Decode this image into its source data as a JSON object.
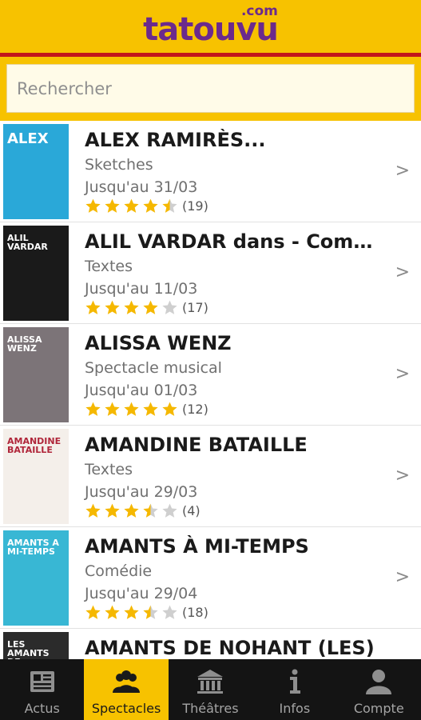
{
  "app": {
    "logo_main": "tatouvu",
    "logo_suffix": ".com",
    "brand_color": "#f7c200",
    "accent_color": "#c2161b",
    "logo_color": "#6b2a8c"
  },
  "search": {
    "placeholder": "Rechercher",
    "value": ""
  },
  "shows": [
    {
      "title": "ALEX RAMIRÈS...",
      "genre": "Sketches",
      "until": "Jusqu'au 31/03",
      "rating": 4.5,
      "reviews": "(19)",
      "poster_text": "ALEX",
      "poster_bg": "#2aa8d8"
    },
    {
      "title": "ALIL VARDAR dans - Commen...",
      "genre": "Textes",
      "until": "Jusqu'au 11/03",
      "rating": 4,
      "reviews": "(17)",
      "poster_text": "ALIL VARDAR",
      "poster_bg": "#1a1a1a"
    },
    {
      "title": "ALISSA WENZ",
      "genre": "Spectacle musical",
      "until": "Jusqu'au 01/03",
      "rating": 5,
      "reviews": "(12)",
      "poster_text": "ALISSA WENZ",
      "poster_bg": "#7c7478"
    },
    {
      "title": "AMANDINE BATAILLE",
      "genre": "Textes",
      "until": "Jusqu'au 29/03",
      "rating": 3.5,
      "reviews": "(4)",
      "poster_text": "AMANDINE BATAILLE",
      "poster_bg": "#f4efea"
    },
    {
      "title": "AMANTS À MI-TEMPS",
      "genre": "Comédie",
      "until": "Jusqu'au 29/04",
      "rating": 3.5,
      "reviews": "(18)",
      "poster_text": "AMANTS A MI-TEMPS",
      "poster_bg": "#38b7d4"
    },
    {
      "title": "AMANTS DE NOHANT (LES)",
      "genre": "",
      "until": "",
      "rating": 0,
      "reviews": "",
      "poster_text": "LES AMANTS DE NOHANT",
      "poster_bg": "#2b2b2b"
    }
  ],
  "tabs": [
    {
      "label": "Actus",
      "icon": "newspaper-icon",
      "active": false
    },
    {
      "label": "Spectacles",
      "icon": "audience-icon",
      "active": true
    },
    {
      "label": "Théâtres",
      "icon": "theater-building-icon",
      "active": false
    },
    {
      "label": "Infos",
      "icon": "info-icon",
      "active": false
    },
    {
      "label": "Compte",
      "icon": "user-icon",
      "active": false
    }
  ]
}
